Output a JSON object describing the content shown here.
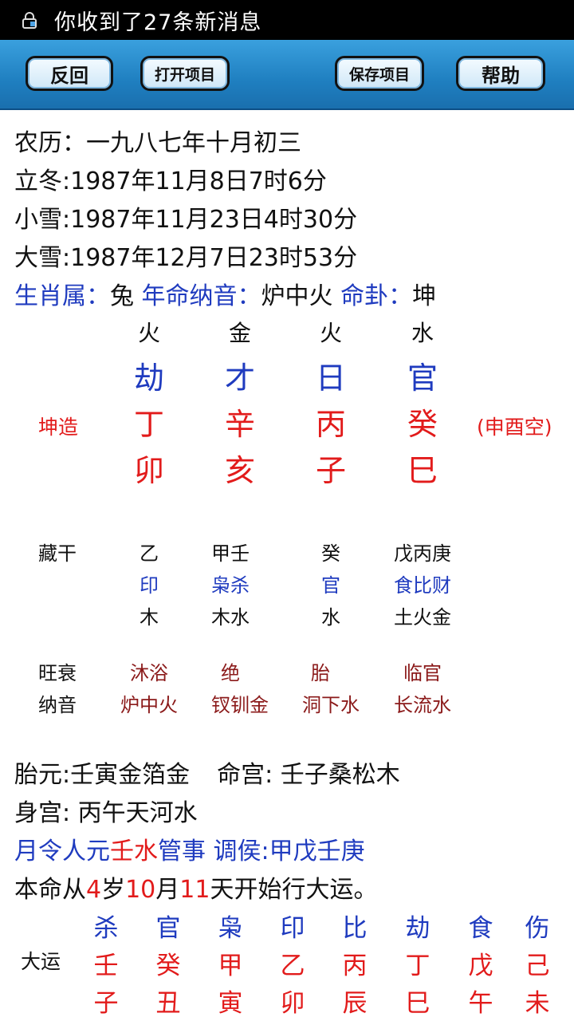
{
  "status_bar": {
    "notification": "你收到了27条新消息",
    "icon": "notification-lock-icon"
  },
  "toolbar": {
    "back": "反回",
    "open": "打开项目",
    "save": "保存项目",
    "help": "帮助"
  },
  "info": {
    "lunar": "农历：一九八七年十月初三",
    "lidong": "立冬:1987年11月8日7时6分",
    "xiaoxue": "小雪:1987年11月23日4时30分",
    "daxue": "大雪:1987年12月7日23时53分",
    "shengxiao_label": "生肖属：",
    "shengxiao_value": "兔",
    "nayin_label": "年命纳音：",
    "nayin_value": "炉中火",
    "minggua_label": "命卦：",
    "minggua_value": "坤"
  },
  "chart": {
    "label": "坤造",
    "kong": "(申酉空)",
    "columns": [
      {
        "wuxing": "火",
        "shishen": "劫",
        "gan": "丁",
        "zhi": "卯"
      },
      {
        "wuxing": "金",
        "shishen": "才",
        "gan": "辛",
        "zhi": "亥"
      },
      {
        "wuxing": "火",
        "shishen": "日",
        "gan": "丙",
        "zhi": "子"
      },
      {
        "wuxing": "水",
        "shishen": "官",
        "gan": "癸",
        "zhi": "巳"
      }
    ]
  },
  "canggan": {
    "label": "藏干",
    "columns": [
      {
        "gan": "乙",
        "shishen": "印",
        "wuxing": "木"
      },
      {
        "gan": "甲壬",
        "shishen": "枭杀",
        "wuxing": "木水"
      },
      {
        "gan": "癸",
        "shishen": "官",
        "wuxing": "水"
      },
      {
        "gan": "戊丙庚",
        "shishen": "食比财",
        "wuxing": "土火金"
      }
    ]
  },
  "wangshuai": {
    "label": "旺衰",
    "values": [
      "沐浴",
      "绝",
      "胎",
      "临官"
    ]
  },
  "nayin_row": {
    "label": "纳音",
    "values": [
      "炉中火",
      "钗钏金",
      "洞下水",
      "长流水"
    ]
  },
  "extra": {
    "taiyuan": "胎元:壬寅金箔金",
    "minggong": "命宫: 壬子桑松木",
    "shengong": "身宫: 丙午天河水",
    "yueling_a": "月令人元",
    "yueling_b": "壬水",
    "yueling_c": "管事 调侯:甲戊壬庚",
    "start_a": "本命从",
    "start_age": "4",
    "start_b": "岁",
    "start_month": "10",
    "start_c": "月",
    "start_day": "11",
    "start_d": "天开始行大运。"
  },
  "dayun": {
    "label": "大运",
    "columns": [
      {
        "shishen": "杀",
        "gan": "壬",
        "zhi": "子"
      },
      {
        "shishen": "官",
        "gan": "癸",
        "zhi": "丑"
      },
      {
        "shishen": "枭",
        "gan": "甲",
        "zhi": "寅"
      },
      {
        "shishen": "印",
        "gan": "乙",
        "zhi": "卯"
      },
      {
        "shishen": "比",
        "gan": "丙",
        "zhi": "辰"
      },
      {
        "shishen": "劫",
        "gan": "丁",
        "zhi": "巳"
      },
      {
        "shishen": "食",
        "gan": "戊",
        "zhi": "午"
      },
      {
        "shishen": "伤",
        "gan": "己",
        "zhi": "未"
      }
    ]
  }
}
